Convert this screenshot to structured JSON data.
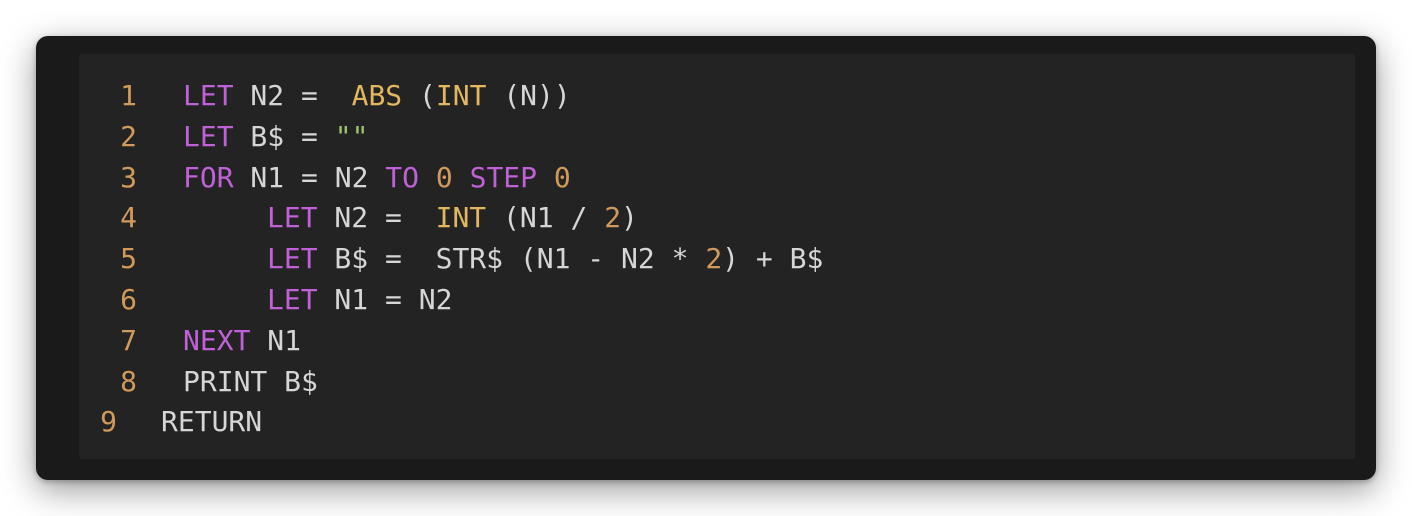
{
  "editor": {
    "lines": [
      {
        "number": "1",
        "indent": 0,
        "tokens": [
          {
            "t": "LET",
            "k": "kw"
          },
          {
            "t": " N2 =  ",
            "k": "txt"
          },
          {
            "t": "ABS",
            "k": "fn"
          },
          {
            "t": " (",
            "k": "txt"
          },
          {
            "t": "INT",
            "k": "fn"
          },
          {
            "t": " (N))",
            "k": "txt"
          }
        ]
      },
      {
        "number": "2",
        "indent": 0,
        "tokens": [
          {
            "t": "LET",
            "k": "kw"
          },
          {
            "t": " B$ = ",
            "k": "txt"
          },
          {
            "t": "\"\"",
            "k": "str"
          }
        ]
      },
      {
        "number": "3",
        "indent": 0,
        "tokens": [
          {
            "t": "FOR",
            "k": "kw"
          },
          {
            "t": " N1 = N2 ",
            "k": "txt"
          },
          {
            "t": "TO",
            "k": "kw"
          },
          {
            "t": " ",
            "k": "txt"
          },
          {
            "t": "0",
            "k": "num"
          },
          {
            "t": " ",
            "k": "txt"
          },
          {
            "t": "STEP",
            "k": "kw"
          },
          {
            "t": " ",
            "k": "txt"
          },
          {
            "t": "0",
            "k": "num"
          }
        ]
      },
      {
        "number": "4",
        "indent": 1,
        "tokens": [
          {
            "t": "LET",
            "k": "kw"
          },
          {
            "t": " N2 =  ",
            "k": "txt"
          },
          {
            "t": "INT",
            "k": "fn"
          },
          {
            "t": " (N1 / ",
            "k": "txt"
          },
          {
            "t": "2",
            "k": "num"
          },
          {
            "t": ")",
            "k": "txt"
          }
        ]
      },
      {
        "number": "5",
        "indent": 1,
        "tokens": [
          {
            "t": "LET",
            "k": "kw"
          },
          {
            "t": " B$ =  STR$ (N1 - N2 * ",
            "k": "txt"
          },
          {
            "t": "2",
            "k": "num"
          },
          {
            "t": ") + B$",
            "k": "txt"
          }
        ]
      },
      {
        "number": "6",
        "indent": 1,
        "tokens": [
          {
            "t": "LET",
            "k": "kw"
          },
          {
            "t": " N1 = N2",
            "k": "txt"
          }
        ]
      },
      {
        "number": "7",
        "indent": 0,
        "tokens": [
          {
            "t": "NEXT",
            "k": "kw"
          },
          {
            "t": " N1",
            "k": "txt"
          }
        ]
      },
      {
        "number": "8",
        "indent": 0,
        "tokens": [
          {
            "t": "PRINT B$",
            "k": "txt"
          }
        ]
      },
      {
        "number": "9",
        "indent": 0,
        "edge": true,
        "tokens": [
          {
            "t": "RETURN",
            "k": "txt"
          }
        ]
      }
    ]
  },
  "colors": {
    "window_bg": "#1a1a1a",
    "editor_bg": "#232323",
    "keyword": "#c061d8",
    "function": "#e3b760",
    "number": "#d29a5a",
    "string": "#9cc36b",
    "text": "#d6d6d6",
    "line_number": "#d29a5a"
  }
}
